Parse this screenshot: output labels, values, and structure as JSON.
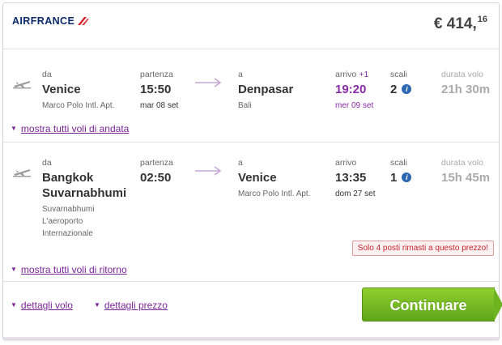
{
  "header": {
    "brand": "AIRFRANCE",
    "price_main": "€ 414,",
    "price_cents": "16"
  },
  "outbound": {
    "from_label": "da",
    "from_city": "Venice",
    "from_airport": "Marco Polo Intl. Apt.",
    "dep_label": "partenza",
    "dep_time": "15:50",
    "dep_date": "mar 08 set",
    "to_label": "a",
    "to_city": "Denpasar",
    "to_airport": "Bali",
    "arr_label": "arrivo",
    "arr_plus": "+1",
    "arr_time": "19:20",
    "arr_date": "mer 09 set",
    "stops_label": "scali",
    "stops": "2",
    "dur_label": "durata volo",
    "duration": "21h 30m",
    "more_link": "mostra tutti voli di andata"
  },
  "return": {
    "from_label": "da",
    "from_city": "Bangkok Suvarnabhumi",
    "from_airport_lines": [
      "Suvarnabhumi",
      "L'aeroporto",
      "Internazionale"
    ],
    "dep_label": "partenza",
    "dep_time": "02:50",
    "to_label": "a",
    "to_city": "Venice",
    "to_airport": "Marco Polo Intl. Apt.",
    "arr_label": "arrivo",
    "arr_time": "13:35",
    "arr_date": "dom 27 set",
    "stops_label": "scali",
    "stops": "1",
    "dur_label": "durata volo",
    "duration": "15h 45m",
    "warning": "Solo 4 posti rimasti a questo prezzo!",
    "more_link": "mostra tutti voli di ritorno"
  },
  "footer": {
    "flight_details": "dettagli volo",
    "price_details": "dettagli prezzo",
    "continue": "Continuare"
  },
  "colors": {
    "accent": "#7b2597",
    "brand": "#0a2a6b",
    "button": "#6eb421",
    "info": "#2e67b1",
    "warning": "#c2262b"
  },
  "icons": {
    "plane": "plane-icon",
    "arrow": "arrow-right-icon",
    "info": "info-icon",
    "caret": "caret-down-icon"
  }
}
